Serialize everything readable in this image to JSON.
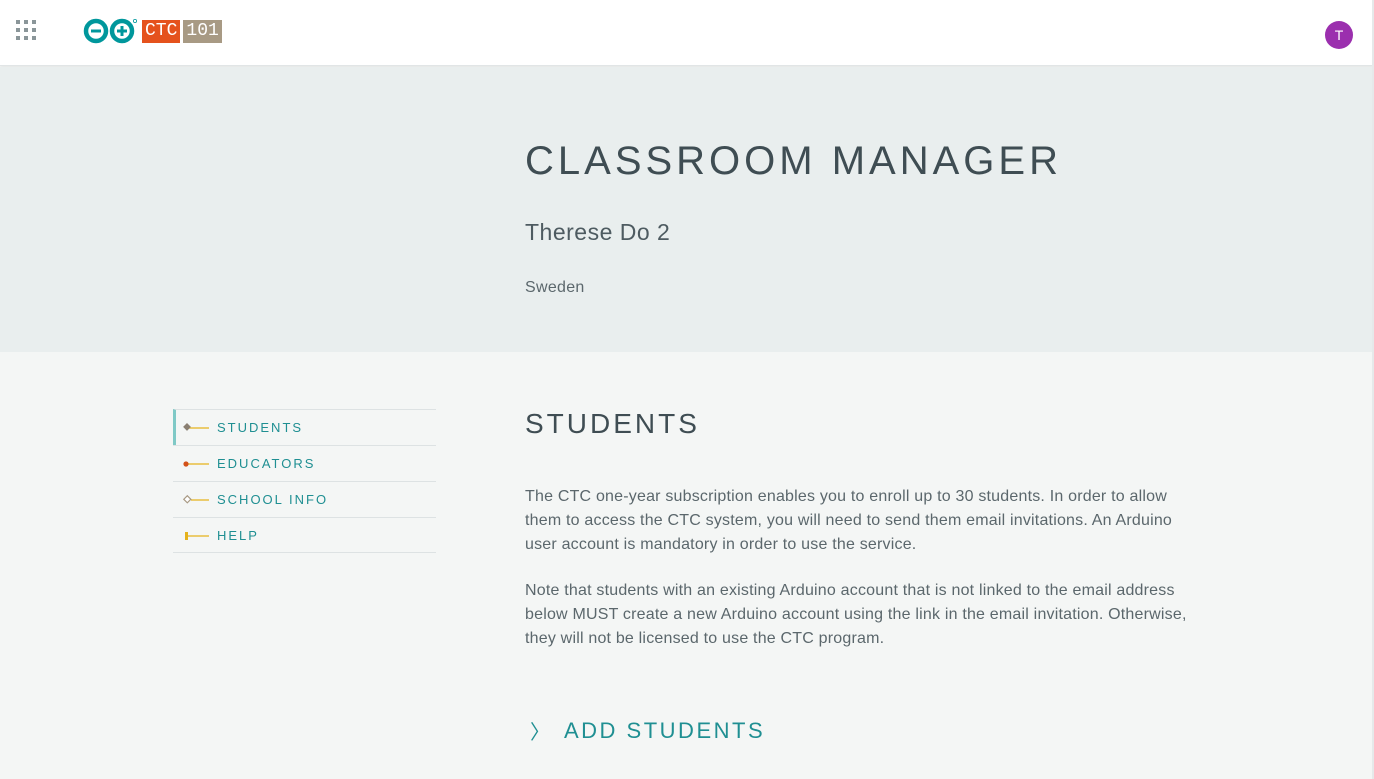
{
  "header": {
    "logo_badge_ctc": "CTC",
    "logo_badge_101": "101",
    "avatar_initial": "T"
  },
  "hero": {
    "title": "CLASSROOM MANAGER",
    "classroom_name": "Therese Do 2",
    "country": "Sweden"
  },
  "sidebar": {
    "items": [
      {
        "label": "STUDENTS",
        "active": true,
        "marker": "diamond",
        "marker_color": "#8a7f72",
        "line_color": "#e5b21c"
      },
      {
        "label": "EDUCATORS",
        "active": false,
        "marker": "dot",
        "marker_color": "#d2511a",
        "line_color": "#e5b21c"
      },
      {
        "label": "SCHOOL INFO",
        "active": false,
        "marker": "diamond-outline",
        "marker_color": "#a89a84",
        "line_color": "#e5b21c"
      },
      {
        "label": "HELP",
        "active": false,
        "marker": "bar",
        "marker_color": "#e5b21c",
        "line_color": "#e5b21c"
      }
    ]
  },
  "main": {
    "section_title": "STUDENTS",
    "paragraph1": "The CTC one-year subscription enables you to enroll up to 30 students. In order to allow them to access the CTC system, you will need to send them email invitations. An Arduino user account is mandatory in order to use the service.",
    "paragraph2": "Note that students with an existing Arduino account that is not linked to the email address below MUST create a new Arduino account using the link in the email invitation. Otherwise, they will not be licensed to use the CTC program.",
    "add_students_chevron": "〉",
    "add_students_label": "ADD STUDENTS"
  },
  "colors": {
    "teal": "#1f8f92",
    "arduino_teal": "#00979c",
    "ctc_orange": "#e5521d",
    "badge_tan": "#a89a84",
    "avatar_purple": "#9b2fae",
    "hero_bg": "#e9eeee",
    "page_bg": "#f4f6f5"
  }
}
